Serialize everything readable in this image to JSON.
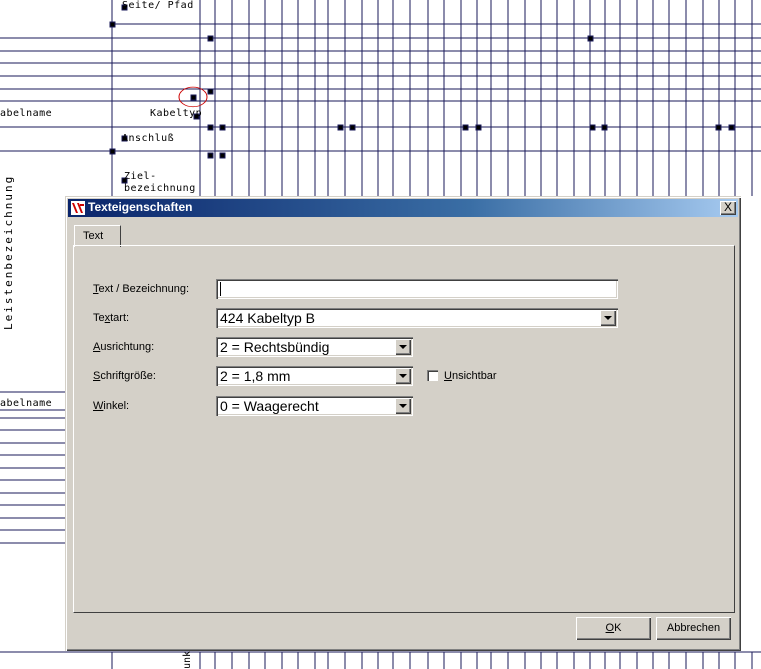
{
  "background": {
    "labels": {
      "seite_pfad": "Seite/ Pfad",
      "kabelname_top": "abelname",
      "kabeltyp": "Kabeltyp",
      "anschluss": "Anschluß",
      "ziel_1": "Ziel-",
      "ziel_2": "bezeichnung",
      "leisten": "Leistenbezeichnung",
      "kabelname_bottom": "abelname",
      "bottom_vertical": "unk"
    }
  },
  "dialog": {
    "title": "Texteigenschaften",
    "close_label": "X",
    "tabs": [
      {
        "label": "Text"
      }
    ],
    "fields": {
      "text_bezeichnung": {
        "label_u": "T",
        "label_rest": "ext / Bezeichnung:",
        "value": ""
      },
      "textart": {
        "label_a": "Te",
        "label_u": "x",
        "label_rest": "tart:",
        "value": "424 Kabeltyp B"
      },
      "ausrichtung": {
        "label_u": "A",
        "label_rest": "usrichtung:",
        "value": "2 = Rechtsbündig"
      },
      "schriftgroesse": {
        "label_u": "S",
        "label_rest": "chriftgröße:",
        "value": "2 = 1,8 mm"
      },
      "winkel": {
        "label_u": "W",
        "label_rest": "inkel:",
        "value": "0 = Waagerecht"
      }
    },
    "unsichtbar": {
      "label_u": "U",
      "label_rest": "nsichtbar",
      "checked": false
    },
    "buttons": {
      "ok_u": "O",
      "ok_rest": "K",
      "abbrechen": "Abbrechen"
    }
  },
  "colors": {
    "title_start": "#0a246a",
    "title_end": "#a6caf0",
    "dialog_bg": "#d4d0c8",
    "grid_line": "#1a1a5a",
    "highlight_circle": "#cc0000"
  }
}
